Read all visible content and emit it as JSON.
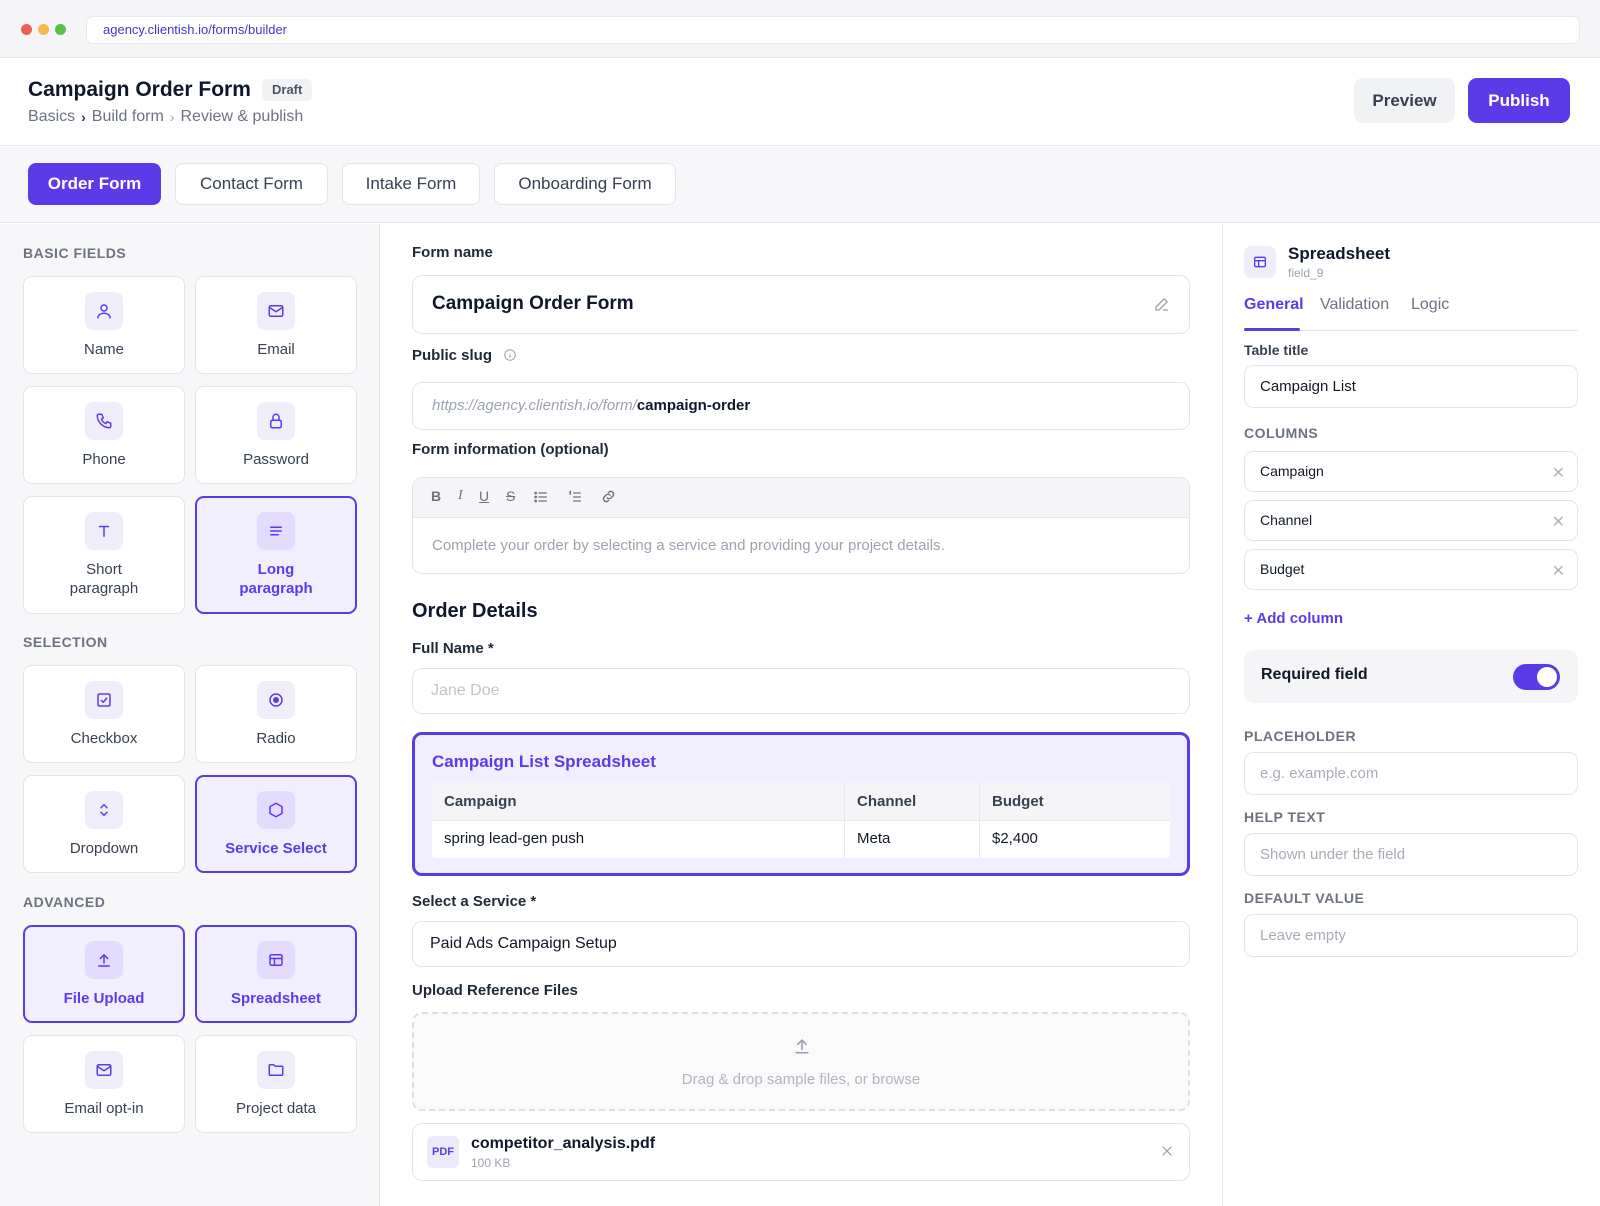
{
  "browser": {
    "url": "agency.clientish.io/forms/builder",
    "dots": [
      "#ee5e57",
      "#f3b94a",
      "#58c04b"
    ]
  },
  "header": {
    "title": "Campaign Order Form",
    "status": "Draft",
    "breadcrumb": [
      "Basics",
      "Build form",
      "Review & publish"
    ],
    "preview_label": "Preview",
    "publish_label": "Publish"
  },
  "form_tabs": [
    "Order Form",
    "Contact Form",
    "Intake Form",
    "Onboarding Form"
  ],
  "palette": {
    "basic_label": "BASIC FIELDS",
    "basic": [
      {
        "label": "Name",
        "icon": "user-icon"
      },
      {
        "label": "Email",
        "icon": "mail-icon"
      },
      {
        "label": "Phone",
        "icon": "phone-icon"
      },
      {
        "label": "Password",
        "icon": "lock-icon"
      },
      {
        "label": "Short paragraph",
        "icon": "text-icon"
      },
      {
        "label": "Long paragraph",
        "icon": "lines-icon",
        "selected": true
      }
    ],
    "selection_label": "SELECTION",
    "selection": [
      {
        "label": "Checkbox",
        "icon": "checkbox-icon"
      },
      {
        "label": "Radio",
        "icon": "radio-icon"
      },
      {
        "label": "Dropdown",
        "icon": "chevrons-icon"
      },
      {
        "label": "Service Select",
        "icon": "hexagon-icon",
        "selected": true
      }
    ],
    "advanced_label": "ADVANCED",
    "advanced": [
      {
        "label": "File Upload",
        "icon": "upload-icon",
        "selected": true
      },
      {
        "label": "Spreadsheet",
        "icon": "table-icon",
        "selected": true
      },
      {
        "label": "Email opt-in",
        "icon": "mail-icon"
      },
      {
        "label": "Project data",
        "icon": "folder-icon"
      }
    ]
  },
  "builder": {
    "form_name_label": "Form name",
    "form_name": "Campaign Order Form",
    "slug_label": "Public slug",
    "slug_prefix": "https://agency.clientish.io/form/",
    "slug_value": "campaign-order",
    "info_label": "Form information (optional)",
    "toolbar": [
      "B",
      "I",
      "U",
      "S"
    ],
    "info_placeholder": "Complete your order by selecting a service and providing your project details.",
    "section_title": "Order Details",
    "full_name_label": "Full Name *",
    "full_name_placeholder": "Jane Doe",
    "spreadsheet": {
      "title": "Campaign List Spreadsheet",
      "columns": [
        "Campaign",
        "Channel",
        "Budget"
      ],
      "rows": [
        [
          "spring lead-gen push",
          "Meta",
          "$2,400"
        ]
      ]
    },
    "service_label": "Select a Service *",
    "service_value": "Paid Ads Campaign Setup",
    "upload_label": "Upload Reference Files",
    "upload_hint": "Drag & drop sample files, or browse",
    "file": {
      "type": "PDF",
      "name": "competitor_analysis.pdf",
      "size": "100 KB"
    }
  },
  "properties": {
    "title": "Spreadsheet",
    "field_id": "field_9",
    "tabs": [
      "General",
      "Validation",
      "Logic"
    ],
    "table_title_label": "Table title",
    "table_title": "Campaign List",
    "columns_label": "COLUMNS",
    "columns": [
      "Campaign",
      "Channel",
      "Budget"
    ],
    "add_column": "+ Add column",
    "required_label": "Required field",
    "required": true,
    "placeholder_label": "PLACEHOLDER",
    "placeholder_hint": "e.g. example.com",
    "help_label": "HELP TEXT",
    "help_hint": "Shown under the field",
    "default_label": "DEFAULT VALUE",
    "default_hint": "Leave empty"
  }
}
